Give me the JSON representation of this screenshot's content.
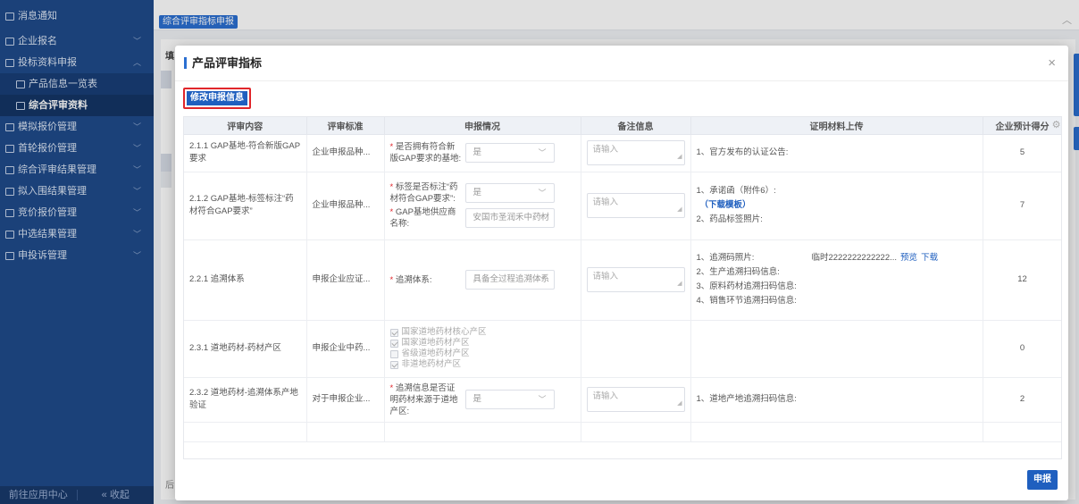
{
  "sidebar": {
    "items": [
      {
        "label": "消息通知",
        "has_chevron": false
      },
      {
        "label": "企业报名",
        "has_chevron": true
      },
      {
        "label": "投标资料申报",
        "has_chevron": true,
        "expanded": true
      },
      {
        "label": "产品信息一览表",
        "sub": true
      },
      {
        "label": "综合评审资料",
        "sub": true,
        "active": true
      },
      {
        "label": "模拟报价管理",
        "has_chevron": true
      },
      {
        "label": "首轮报价管理",
        "has_chevron": true
      },
      {
        "label": "综合评审结果管理",
        "has_chevron": true
      },
      {
        "label": "拟入围结果管理",
        "has_chevron": true
      },
      {
        "label": "竞价报价管理",
        "has_chevron": true
      },
      {
        "label": "中选结果管理",
        "has_chevron": true
      },
      {
        "label": "申投诉管理",
        "has_chevron": true
      }
    ],
    "bottom_left": "前往应用中心",
    "bottom_right": "« 收起"
  },
  "topbar": {
    "tab_label": "综合评审指标申报"
  },
  "background": {
    "label_fill": "填",
    "label_hang": "后"
  },
  "modal": {
    "title": "产品评审指标",
    "close_icon": "×",
    "modify_button": "修改申报信息",
    "submit_button": "申报",
    "table": {
      "headers": [
        "评审内容",
        "评审标准",
        "申报情况",
        "备注信息",
        "证明材料上传",
        "企业预计得分"
      ],
      "rows": [
        {
          "content": "2.1.1 GAP基地-符合新版GAP要求",
          "standard": "企业申报品种...",
          "fields": [
            {
              "label": "是否拥有符合新版GAP要求的基地:",
              "required": true,
              "value": "是"
            }
          ],
          "remark_placeholder": "请输入",
          "proofs": [
            {
              "text": "1、官方发布的认证公告:"
            }
          ],
          "score": "5"
        },
        {
          "content": "2.1.2 GAP基地-标签标注“药材符合GAP要求”",
          "standard": "企业申报品种...",
          "fields": [
            {
              "label": "标签是否标注“药材符合GAP要求”:",
              "required": true,
              "value": "是"
            },
            {
              "label": "GAP基地供应商名称:",
              "required": true,
              "value": "安国市圣润禾中药材"
            }
          ],
          "remark_placeholder": "请输入",
          "proofs": [
            {
              "text": "1、承诺函（附件6）:"
            },
            {
              "text": "（下载模板）",
              "link": true
            },
            {
              "text": "2、药品标签照片:"
            }
          ],
          "score": "7"
        },
        {
          "content": "2.2.1 追溯体系",
          "standard": "申报企业应证...",
          "fields": [
            {
              "label": "追溯体系:",
              "required": true,
              "value": "具备全过程追溯体系"
            }
          ],
          "remark_placeholder": "请输入",
          "proofs": [
            {
              "text": "1、追溯码照片:",
              "file": "临时2222222222222...",
              "preview": "预览",
              "download": "下载"
            },
            {
              "text": "2、生产追溯扫码信息:"
            },
            {
              "text": "3、原料药材追溯扫码信息:"
            },
            {
              "text": "4、销售环节追溯扫码信息:"
            }
          ],
          "score": "12"
        },
        {
          "content": "2.3.1 道地药材-药材产区",
          "standard": "申报企业中药...",
          "checkboxes": [
            {
              "label": "国家道地药材核心产区",
              "checked": true
            },
            {
              "label": "国家道地药材产区",
              "checked": true
            },
            {
              "label": "省级道地药材产区",
              "checked": false
            },
            {
              "label": "非道地药材产区",
              "checked": true
            }
          ],
          "score": "0"
        },
        {
          "content": "2.3.2 道地药材-追溯体系产地验证",
          "standard": "对于申报企业...",
          "fields": [
            {
              "label": "追溯信息是否证明药材来源于道地产区:",
              "required": true,
              "value": "是"
            }
          ],
          "remark_placeholder": "请输入",
          "proofs": [
            {
              "text": "1、道地产地追溯扫码信息:"
            }
          ],
          "score": "2"
        }
      ]
    }
  }
}
